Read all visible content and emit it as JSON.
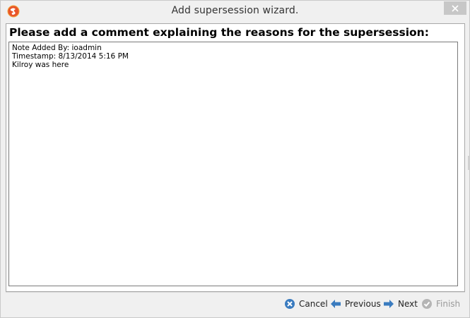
{
  "window": {
    "title": "Add supersession wizard.",
    "app_icon": "app-logo-icon",
    "close_icon": "close-icon"
  },
  "content": {
    "heading": "Please add a comment explaining the reasons for the supersession:",
    "comment_lines": [
      "Note Added By: ioadmin",
      "Timestamp: 8/13/2014 5:16 PM",
      "Kilroy was here"
    ]
  },
  "footer": {
    "cancel_label": "Cancel",
    "previous_label": "Previous",
    "next_label": "Next",
    "finish_label": "Finish",
    "finish_enabled": false,
    "accent_color": "#3a7bbf"
  }
}
